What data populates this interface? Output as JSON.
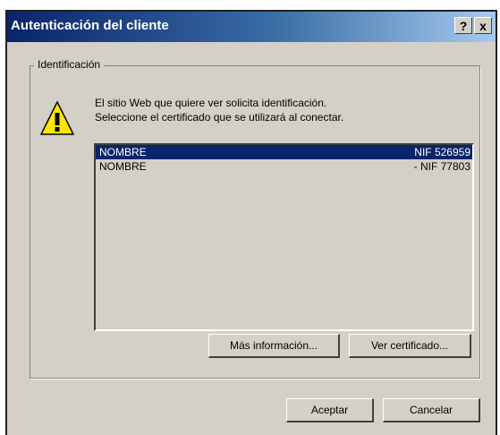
{
  "window": {
    "title": "Autenticación del cliente",
    "help_label": "?",
    "close_label": "x"
  },
  "group": {
    "label": "Identificación"
  },
  "message": {
    "line1": "El sitio Web que quiere ver solicita identificación.",
    "line2": "Seleccione el certificado que se utilizará al conectar."
  },
  "certificates": [
    {
      "name": "NOMBRE",
      "nif": "NIF 526959",
      "selected": true
    },
    {
      "name": "NOMBRE",
      "nif": "- NIF 77803",
      "selected": false
    }
  ],
  "buttons": {
    "more_info": "Más información...",
    "view_cert": "Ver certificado...",
    "accept": "Aceptar",
    "cancel": "Cancelar"
  },
  "icons": {
    "warning": "warning-icon"
  },
  "colors": {
    "selection": "#0a246a",
    "title_start": "#0a246a",
    "title_end": "#a6caf0"
  }
}
